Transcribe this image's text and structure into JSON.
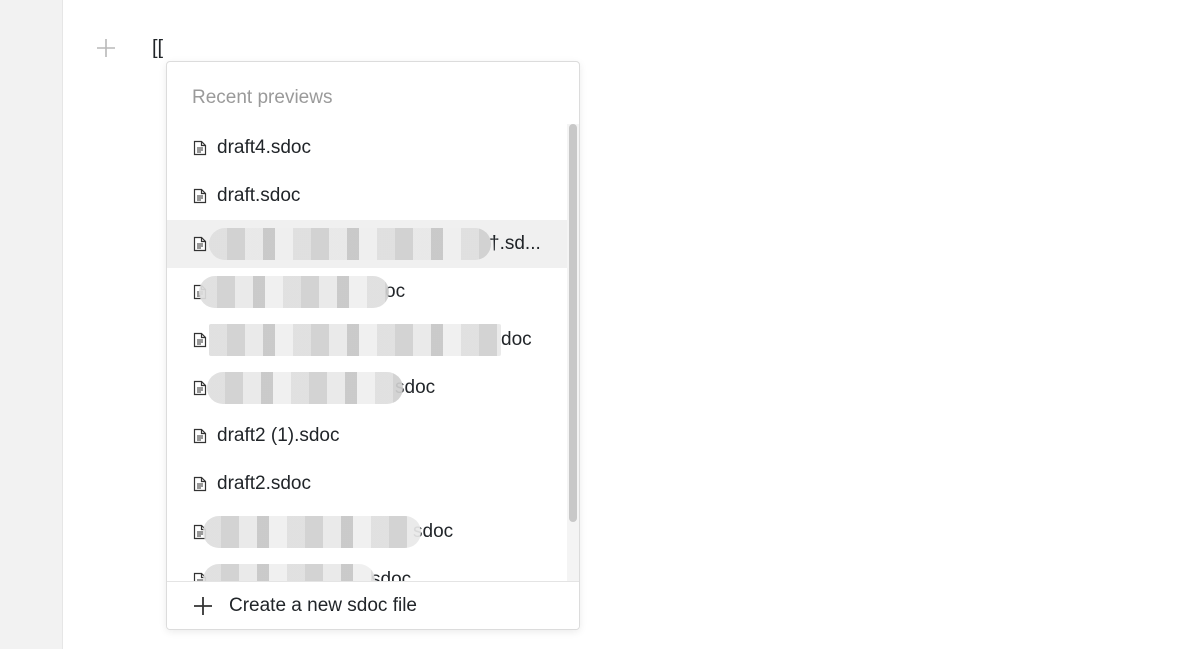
{
  "editor": {
    "typed_text": "[["
  },
  "popup": {
    "header": "Recent previews",
    "items": [
      {
        "label": "draft4.sdoc",
        "redacted": false
      },
      {
        "label": "draft.sdoc",
        "redacted": false
      },
      {
        "label": "†.sd...",
        "redacted": true,
        "active": true
      },
      {
        "label": "oc",
        "redacted": true
      },
      {
        "label": "doc",
        "redacted": true
      },
      {
        "label": "sdoc",
        "redacted": true
      },
      {
        "label": "draft2 (1).sdoc",
        "redacted": false
      },
      {
        "label": "draft2.sdoc",
        "redacted": false
      },
      {
        "label": "sdoc",
        "redacted": true
      },
      {
        "label": "sdoc",
        "redacted": true
      }
    ],
    "footer_label": "Create a new sdoc file",
    "icons": {
      "add_block": "plus-icon",
      "file": "sdoc-file-icon",
      "create": "plus-icon"
    }
  }
}
